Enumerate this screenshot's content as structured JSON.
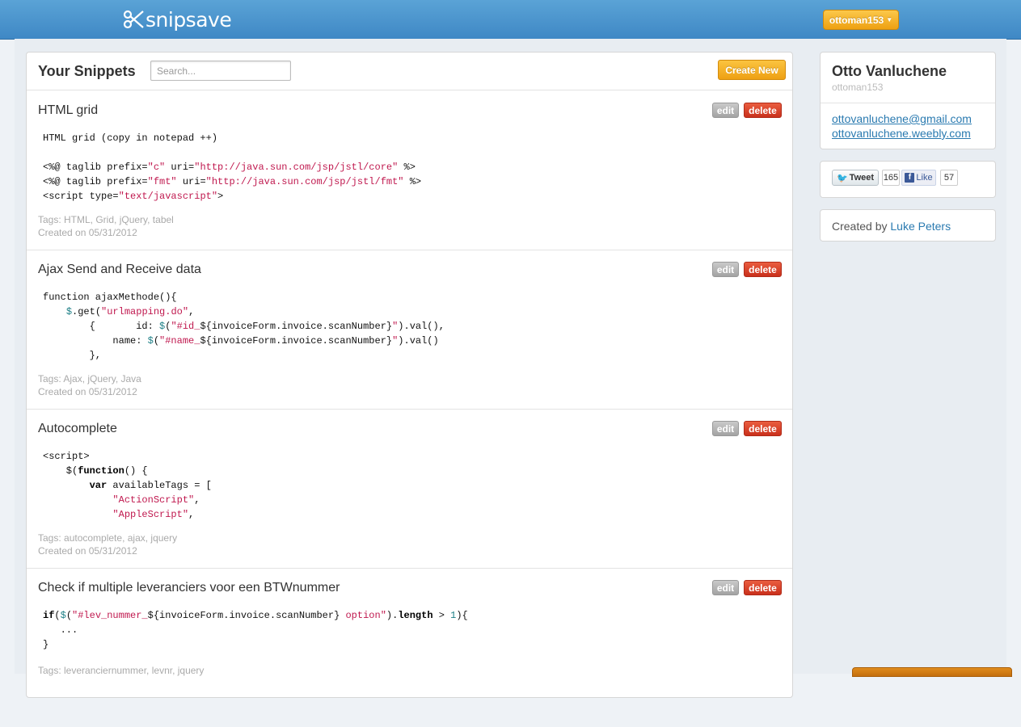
{
  "app": {
    "logo_text": "snipsave"
  },
  "user_menu": {
    "label": "ottoman153"
  },
  "main": {
    "title": "Your Snippets",
    "search_placeholder": "Search...",
    "create_label": "Create New",
    "edit_label": "edit",
    "delete_label": "delete",
    "snippets": [
      {
        "title": "HTML grid",
        "tags": "Tags: HTML, Grid, jQuery, tabel",
        "created": "Created on 05/31/2012"
      },
      {
        "title": "Ajax Send and Receive data",
        "tags": "Tags: Ajax, jQuery, Java",
        "created": "Created on 05/31/2012"
      },
      {
        "title": "Autocomplete",
        "tags": "Tags: autocomplete, ajax, jquery",
        "created": "Created on 05/31/2012"
      },
      {
        "title": "Check if multiple leveranciers voor een BTWnummer",
        "tags": "Tags: leveranciernummer, levnr, jquery",
        "created": ""
      }
    ]
  },
  "profile": {
    "name": "Otto Vanluchene",
    "username": "ottoman153",
    "email": "ottovanluchene@gmail.com",
    "website": "ottovanluchene.weebly.com"
  },
  "social": {
    "tweet_label": "Tweet",
    "tweet_count": "165",
    "like_label": "Like",
    "like_count": "57"
  },
  "credits": {
    "prefix": "Created by",
    "author": "Luke Peters"
  }
}
